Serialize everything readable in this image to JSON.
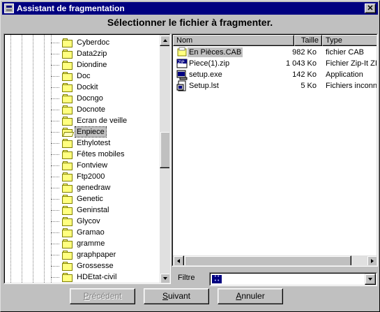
{
  "window": {
    "title": "Assistant de fragmentation",
    "close_label": "✕"
  },
  "heading": "Sélectionner le fichier à fragmenter.",
  "tree": {
    "selected": "Enpiece",
    "items": [
      "Cyberdoc",
      "Data2zip",
      "Diondine",
      "Doc",
      "Dockit",
      "Docngo",
      "Docnote",
      "Ecran de veille",
      "Enpiece",
      "Ethylotest",
      "Fêtes mobiles",
      "Fontview",
      "Ftp2000",
      "genedraw",
      "Genetic",
      "Geninstal",
      "Glycov",
      "Gramao",
      "gramme",
      "graphpaper",
      "Grossesse",
      "HDEtat-civil"
    ]
  },
  "files": {
    "columns": [
      "Nom",
      "Taille",
      "Type"
    ],
    "rows": [
      {
        "name": "En Pièces.CAB",
        "size": "982 Ko",
        "type": "fichier CAB",
        "icon": "cab-file-icon",
        "selected": true
      },
      {
        "name": "Piece(1).zip",
        "size": "1 043 Ko",
        "type": "Fichier Zip-It ZI",
        "icon": "zip-file-icon",
        "selected": false
      },
      {
        "name": "setup.exe",
        "size": "142 Ko",
        "type": "Application",
        "icon": "exe-file-icon",
        "selected": false
      },
      {
        "name": "Setup.lst",
        "size": "5 Ko",
        "type": "Fichiers inconn",
        "icon": "lst-file-icon",
        "selected": false
      }
    ]
  },
  "filter": {
    "label": "Filtre",
    "value": ""
  },
  "buttons": {
    "previous": {
      "label_u": "P",
      "label_rest": "récédent",
      "disabled": true
    },
    "next": {
      "label_u": "S",
      "label_rest": "uivant",
      "disabled": false
    },
    "cancel": {
      "label_u": "A",
      "label_rest": "nnuler",
      "disabled": false
    }
  },
  "colors": {
    "titlebar": "#000080",
    "face": "#c0c0c0",
    "folder": "#ffff80"
  }
}
